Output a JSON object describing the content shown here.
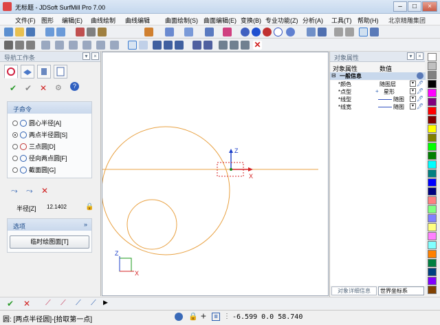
{
  "window": {
    "title": "无标题 - JDSoft SurfMill Pro 7.00",
    "minimize": "–",
    "maximize": "□",
    "close": "×"
  },
  "menu": [
    "文件(F)",
    "图形",
    "编辑(E)",
    "曲线绘制",
    "曲线编辑",
    "曲面绘制(S)",
    "曲面编辑(E)",
    "变换(B)",
    "专业功能(Z)",
    "分析(A)",
    "工具(T)",
    "帮助(H)",
    "北京精雕集团"
  ],
  "nav": {
    "title": "导航工作条",
    "subcommand_title": "子命令",
    "options": [
      {
        "label": "圆心半径[A]",
        "selected": false
      },
      {
        "label": "两点半径圆[S]",
        "selected": true
      },
      {
        "label": "三点圆[D]",
        "selected": false
      },
      {
        "label": "径向两点圆[F]",
        "selected": false
      },
      {
        "label": "截面圆[G]",
        "selected": false
      }
    ],
    "radius_label": "半径[Z]",
    "radius_value": "12.1402",
    "options_title": "选项",
    "temp_plane_button": "临时绘图面[T]"
  },
  "props": {
    "title": "对象属性",
    "col_prop": "对象属性",
    "col_value": "数值",
    "group": "一般信息",
    "rows": [
      {
        "name": "*颜色",
        "value": "随图层"
      },
      {
        "name": "*点型",
        "value": "星形"
      },
      {
        "name": "*线型",
        "value": "随图"
      },
      {
        "name": "*线宽",
        "value": "随图"
      }
    ],
    "tab_detail": "对象详细信息",
    "coord_select": "世界坐标系"
  },
  "canvas": {
    "axis_z": "Z",
    "axis_x": "X",
    "mini_z": "Z",
    "mini_x": "X"
  },
  "status": {
    "prompt": "圆: [两点半径圆]-[拾取第一点]",
    "coords": "-6.599 0.0 58.740"
  },
  "colors": {
    "accent": "#1c4b8a",
    "curve": "#e8a040",
    "axis_z": "#1a3ec8",
    "axis_x": "#d42020"
  },
  "palette": [
    "#ffffff",
    "#c0c0c0",
    "#808080",
    "#000000",
    "#ff00ff",
    "#800080",
    "#ff0000",
    "#800000",
    "#ffff00",
    "#808000",
    "#00ff00",
    "#008000",
    "#00ffff",
    "#008080",
    "#0000ff",
    "#000080",
    "#ff8080",
    "#80ff80",
    "#8080ff",
    "#ffff80",
    "#ff80ff",
    "#80ffff",
    "#ff8000",
    "#008040",
    "#004080",
    "#8000ff",
    "#804000",
    "#408000"
  ]
}
